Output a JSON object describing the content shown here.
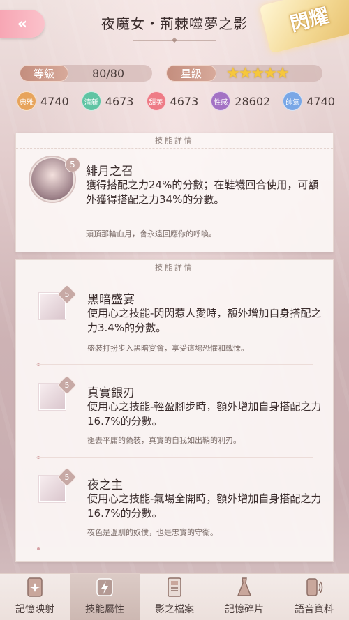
{
  "header": {
    "title": "夜魔女・荊棘噬夢之影",
    "badge": "閃耀"
  },
  "stats": {
    "level_label": "等級",
    "level_value": "80/80",
    "star_label": "星級",
    "stars": 5
  },
  "attributes": [
    {
      "name": "典雅",
      "value": "4740",
      "color": "#e7a45c"
    },
    {
      "name": "清新",
      "value": "4673",
      "color": "#5fc4a3"
    },
    {
      "name": "甜美",
      "value": "4673",
      "color": "#ee7b86"
    },
    {
      "name": "性感",
      "value": "28602",
      "color": "#a372c4"
    },
    {
      "name": "帥氣",
      "value": "4740",
      "color": "#79a7e6"
    }
  ],
  "main_skill_panel": {
    "heading": "技能詳情",
    "name": "緋月之召",
    "level": "5",
    "desc": "獲得搭配之力24%的分數；在鞋襪回合使用，可額外獲得搭配之力34%的分數。",
    "flavor": "頭頂那輪血月，會永遠回應你的呼喚。"
  },
  "sub_skill_panel": {
    "heading": "技能詳情",
    "skills": [
      {
        "name": "黑暗盛宴",
        "level": "5",
        "desc": "使用心之技能-閃閃惹人愛時，額外增加自身搭配之力3.4%的分數。",
        "flavor": "盛裝打扮步入黑暗宴會，享受這場恐懼和戰慄。"
      },
      {
        "name": "真實銀刃",
        "level": "5",
        "desc": "使用心之技能-輕盈腳步時，額外增加自身搭配之力16.7%的分數。",
        "flavor": "褪去平庸的偽裝，真實的自我如出鞘的利刃。"
      },
      {
        "name": "夜之主",
        "level": "5",
        "desc": "使用心之技能-氣場全開時，額外增加自身搭配之力16.7%的分數。",
        "flavor": "夜色是溫馴的奴僕，也是忠實的守衛。"
      }
    ]
  },
  "tabs": [
    {
      "label": "記憶映射",
      "icon": "card-icon"
    },
    {
      "label": "技能屬性",
      "icon": "lightning-icon",
      "active": true
    },
    {
      "label": "影之檔案",
      "icon": "document-icon"
    },
    {
      "label": "記憶碎片",
      "icon": "dress-icon"
    },
    {
      "label": "語音資料",
      "icon": "phone-audio-icon"
    }
  ]
}
